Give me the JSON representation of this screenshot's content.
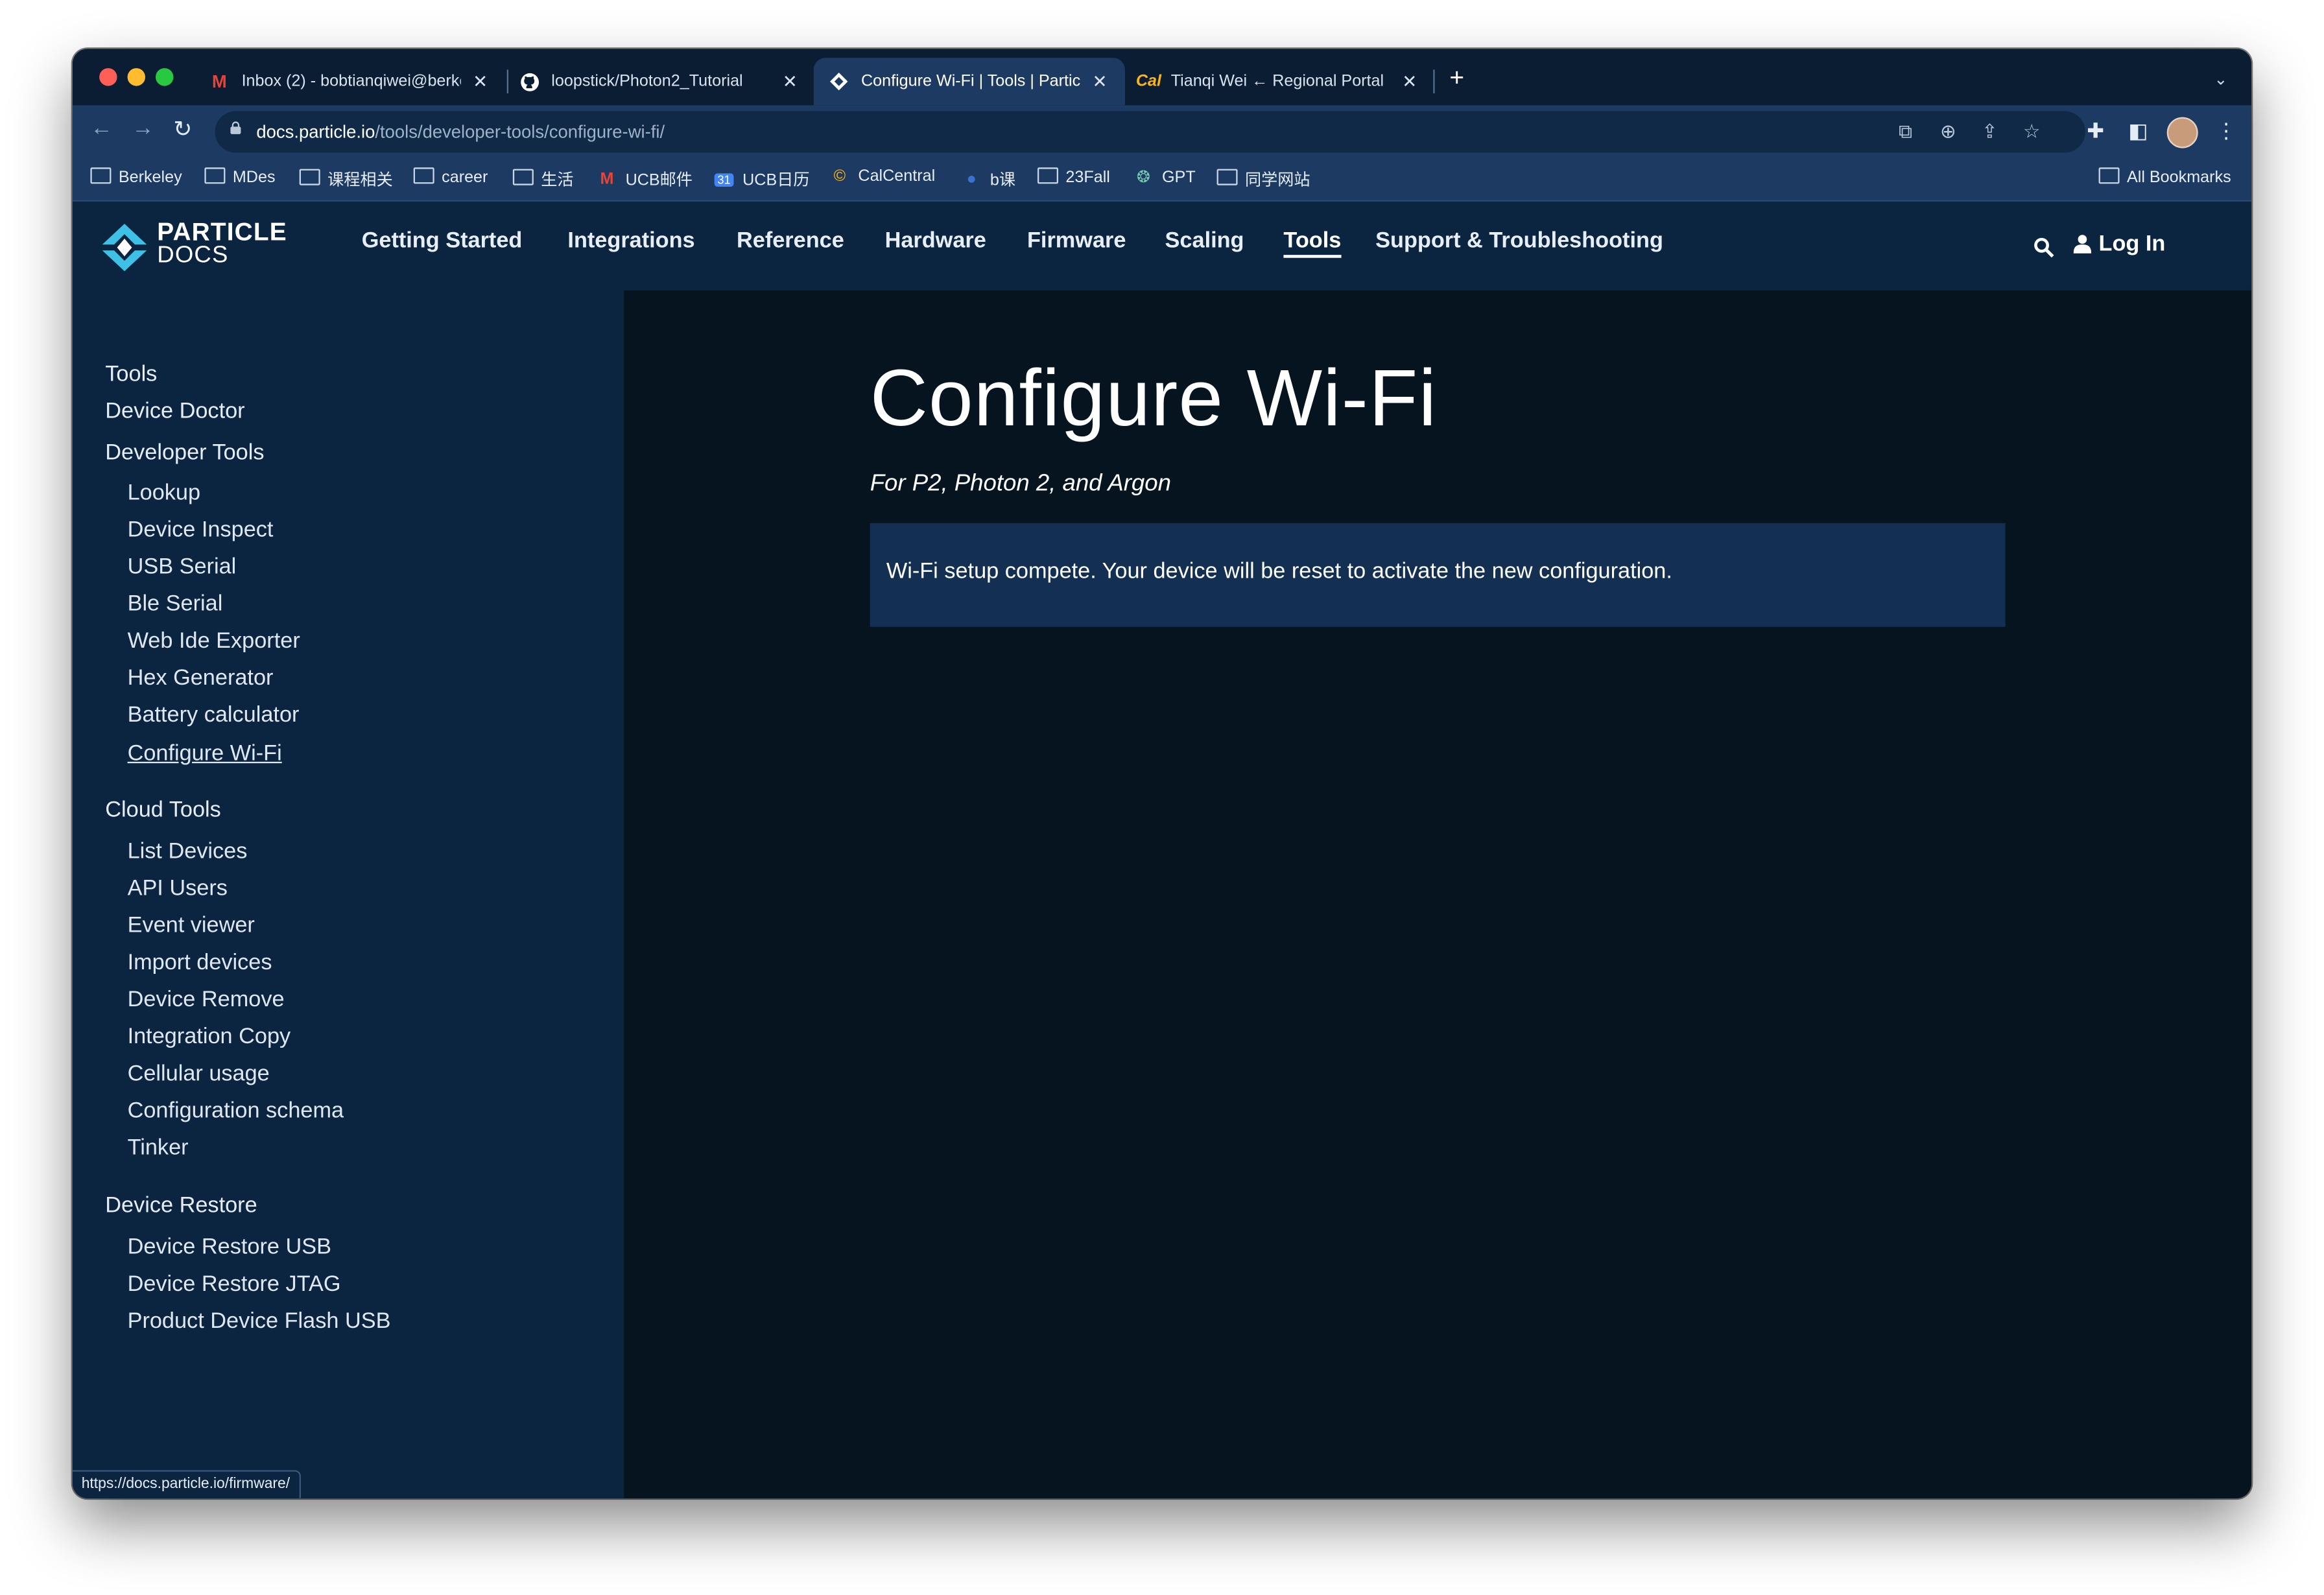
{
  "browser": {
    "tabs": [
      {
        "label": "Inbox (2) - bobtianqiwei@berkel",
        "icon": "gmail-icon",
        "active": false
      },
      {
        "label": "loopstick/Photon2_Tutorial",
        "icon": "github-icon",
        "active": false
      },
      {
        "label": "Configure Wi-Fi | Tools | Particl",
        "icon": "particle-icon",
        "active": true
      },
      {
        "label": "Tianqi Wei ← Regional Portal",
        "icon": "cal-icon",
        "active": false
      }
    ],
    "new_tab": "+",
    "tab_menu": "⌄",
    "url_host": "docs.particle.io",
    "url_path": "/tools/developer-tools/configure-wi-fi/",
    "bookmarks": [
      {
        "label": "Berkeley",
        "icon": "folder-icon"
      },
      {
        "label": "MDes",
        "icon": "folder-icon"
      },
      {
        "label": "课程相关",
        "icon": "folder-icon"
      },
      {
        "label": "career",
        "icon": "folder-icon"
      },
      {
        "label": "生活",
        "icon": "folder-icon"
      },
      {
        "label": "UCB邮件",
        "icon": "gmail-icon"
      },
      {
        "label": "UCB日历",
        "icon": "calendar-icon"
      },
      {
        "label": "CalCentral",
        "icon": "calcentral-icon"
      },
      {
        "label": "b课",
        "icon": "bcourses-icon"
      },
      {
        "label": "23Fall",
        "icon": "folder-icon"
      },
      {
        "label": "GPT",
        "icon": "chatgpt-icon"
      },
      {
        "label": "同学网站",
        "icon": "folder-icon"
      }
    ],
    "all_bookmarks": "All Bookmarks",
    "status_url": "https://docs.particle.io/firmware/"
  },
  "site": {
    "logo_line1": "PARTICLE",
    "logo_line2": "DOCS",
    "nav": [
      {
        "label": "Getting Started",
        "active": false
      },
      {
        "label": "Integrations",
        "active": false
      },
      {
        "label": "Reference",
        "active": false
      },
      {
        "label": "Hardware",
        "active": false
      },
      {
        "label": "Firmware",
        "active": false
      },
      {
        "label": "Scaling",
        "active": false
      },
      {
        "label": "Tools",
        "active": true
      },
      {
        "label": "Support & Troubleshooting",
        "active": false
      }
    ],
    "login": "Log In"
  },
  "sidebar": {
    "items": [
      {
        "label": "Tools",
        "level": 0
      },
      {
        "label": "Device Doctor",
        "level": 0
      },
      {
        "label": "Developer Tools",
        "level": 0
      },
      {
        "label": "Lookup",
        "level": 1
      },
      {
        "label": "Device Inspect",
        "level": 1
      },
      {
        "label": "USB Serial",
        "level": 1
      },
      {
        "label": "Ble Serial",
        "level": 1
      },
      {
        "label": "Web Ide Exporter",
        "level": 1
      },
      {
        "label": "Hex Generator",
        "level": 1
      },
      {
        "label": "Battery calculator",
        "level": 1
      },
      {
        "label": "Configure Wi-Fi",
        "level": 1,
        "current": true
      },
      {
        "label": "Cloud Tools",
        "level": 0
      },
      {
        "label": "List Devices",
        "level": 1
      },
      {
        "label": "API Users",
        "level": 1
      },
      {
        "label": "Event viewer",
        "level": 1
      },
      {
        "label": "Import devices",
        "level": 1
      },
      {
        "label": "Device Remove",
        "level": 1
      },
      {
        "label": "Integration Copy",
        "level": 1
      },
      {
        "label": "Cellular usage",
        "level": 1
      },
      {
        "label": "Configuration schema",
        "level": 1
      },
      {
        "label": "Tinker",
        "level": 1
      },
      {
        "label": "Device Restore",
        "level": 0
      },
      {
        "label": "Device Restore USB",
        "level": 1
      },
      {
        "label": "Device Restore JTAG",
        "level": 1
      },
      {
        "label": "Product Device Flash USB",
        "level": 1
      }
    ]
  },
  "main": {
    "title": "Configure Wi-Fi",
    "subtitle": "For P2, Photon 2, and Argon",
    "notice": "Wi-Fi setup compete. Your device will be reset to activate the new configuration."
  },
  "colors": {
    "header_bg": "#0b2540",
    "main_bg": "#061420",
    "notice_bg": "#133052",
    "chrome_bg": "#1d3a63",
    "logo_accent": "#3ec1e4"
  }
}
